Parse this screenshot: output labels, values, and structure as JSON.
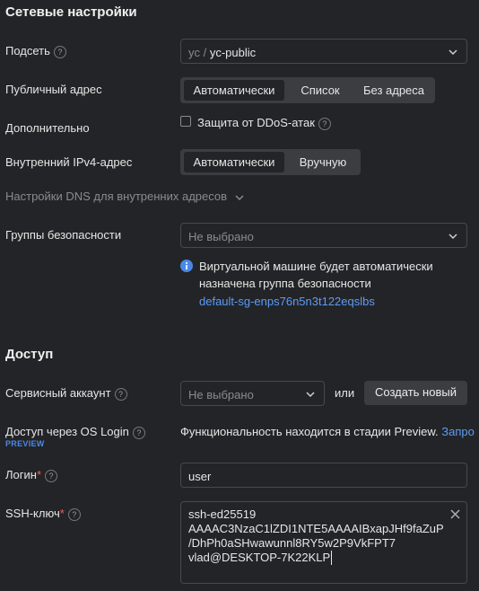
{
  "network": {
    "title": "Сетевые настройки",
    "subnet": {
      "label": "Подсеть",
      "prefix": "yc / ",
      "value": "yc-public"
    },
    "public_address": {
      "label": "Публичный адрес",
      "options": [
        "Автоматически",
        "Список",
        "Без адреса"
      ],
      "selected": "Автоматически"
    },
    "extra": {
      "label": "Дополнительно",
      "ddos_label": "Защита от DDoS-атак",
      "ddos_checked": false
    },
    "internal_ipv4": {
      "label": "Внутренний IPv4-адрес",
      "options": [
        "Автоматически",
        "Вручную"
      ],
      "selected": "Автоматически"
    },
    "dns": {
      "label": "Настройки DNS для внутренних адресов"
    },
    "security_groups": {
      "label": "Группы безопасности",
      "placeholder": "Не выбрано",
      "info_line1": "Виртуальной машине будет автоматически",
      "info_line2": "назначена группа безопасности",
      "info_link": "default-sg-enps76n5n3t122eqslbs"
    }
  },
  "access": {
    "title": "Доступ",
    "service_account": {
      "label": "Сервисный аккаунт",
      "placeholder": "Не выбрано",
      "or": "или",
      "create_button": "Создать новый"
    },
    "os_login": {
      "label": "Доступ через OS Login",
      "badge": "PREVIEW",
      "note": "Функциональность находится в стадии Preview.",
      "link": "Запро"
    },
    "login": {
      "label": "Логин",
      "required": "*",
      "value": "user"
    },
    "ssh_key": {
      "label": "SSH-ключ",
      "required": "*",
      "lines": [
        "ssh-ed25519",
        "AAAAC3NzaC1lZDI1NTE5AAAAIBxapJHf9faZuP",
        "/DhPh0aSHwawunnl8RY5w2P9VkFPT7",
        "vlad@DESKTOP-7K22KLP"
      ]
    }
  },
  "colors": {
    "background": "#232427",
    "accent": "#5b9cf7",
    "required": "#ff5a5a",
    "preview_badge": "#4a88e8"
  }
}
